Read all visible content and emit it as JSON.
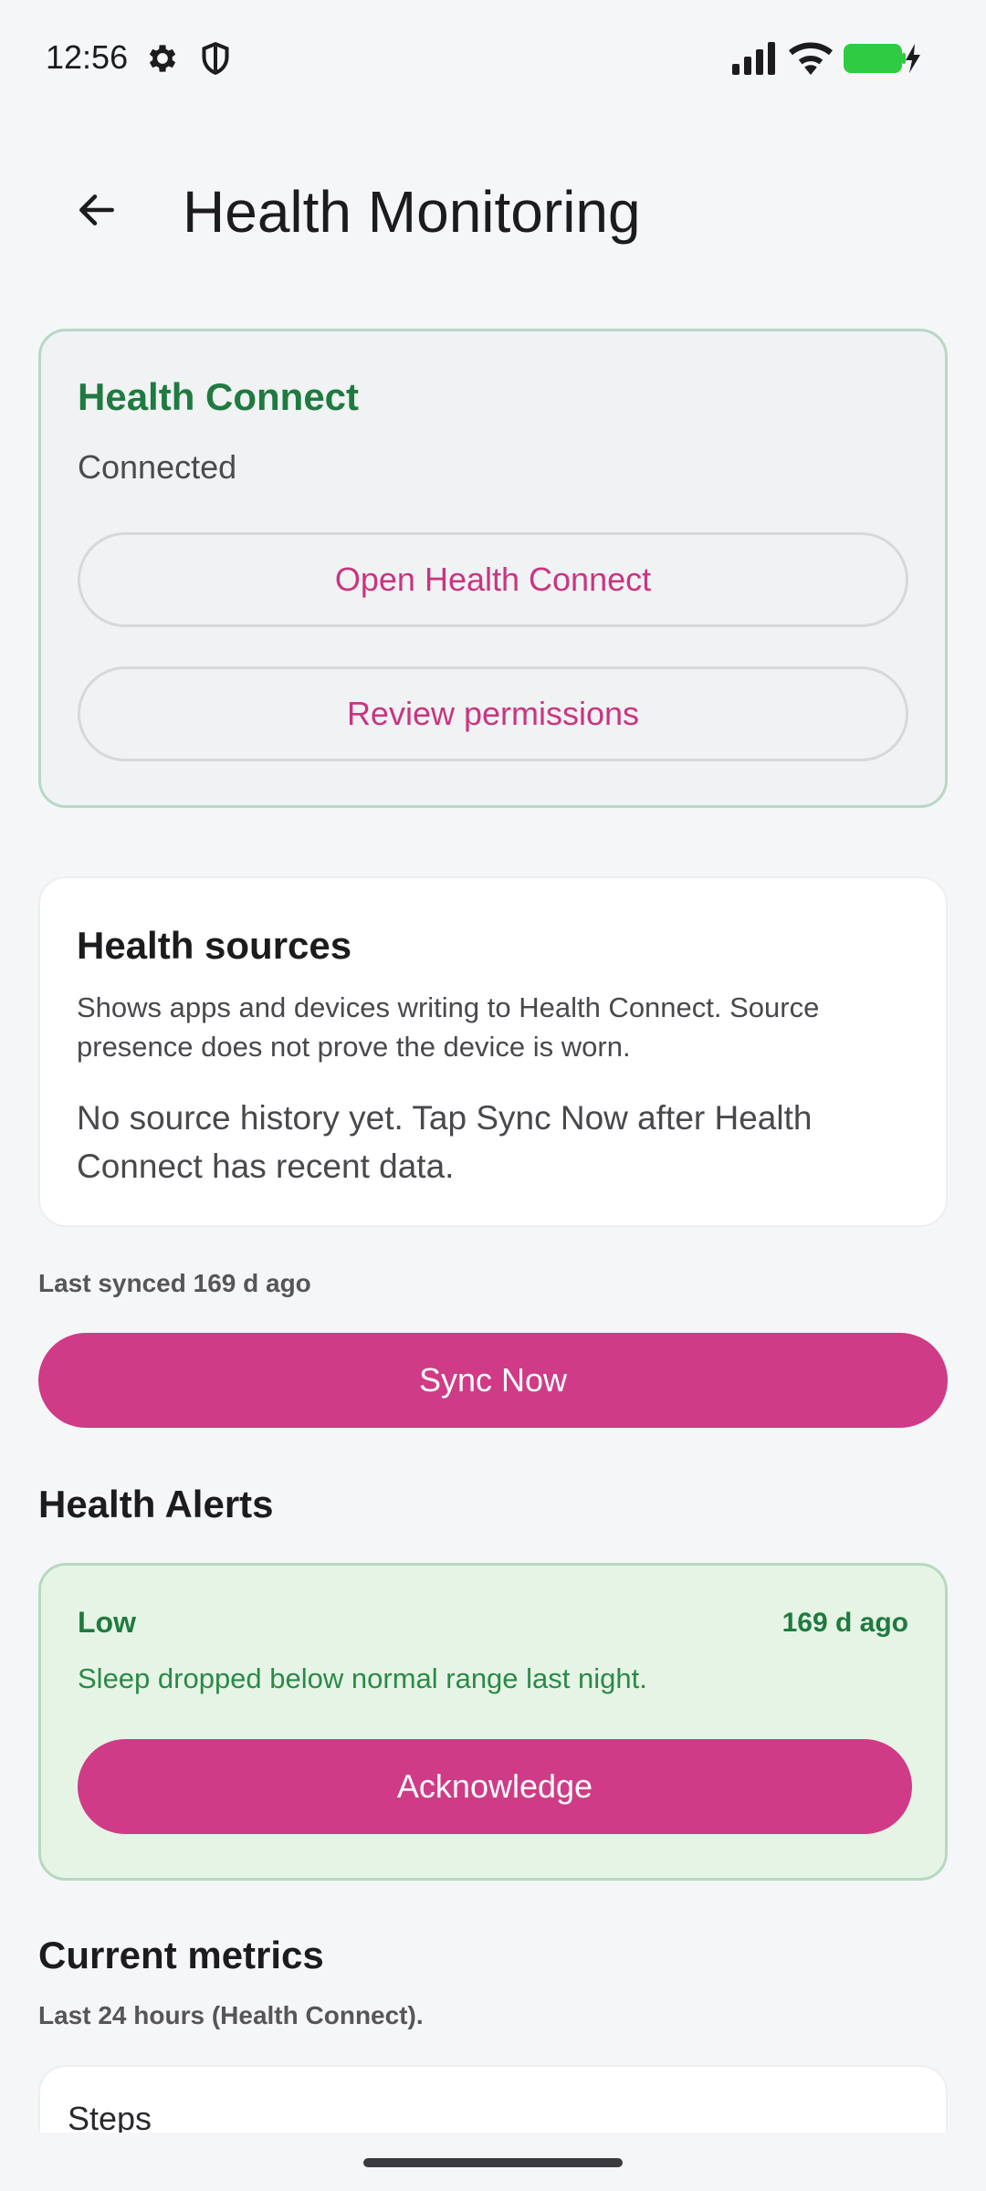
{
  "status_bar": {
    "time": "12:56",
    "icons": [
      "gear-icon",
      "shield-icon",
      "signal-icon",
      "wifi-icon",
      "battery-charging-icon"
    ],
    "battery_color": "#2ecc40"
  },
  "app_bar": {
    "back_icon": "arrow-left-icon",
    "title": "Health Monitoring"
  },
  "health_connect": {
    "title": "Health Connect",
    "status": "Connected",
    "open_label": "Open Health Connect",
    "review_label": "Review permissions"
  },
  "health_sources": {
    "title": "Health sources",
    "description": "Shows apps and devices writing to Health Connect. Source presence does not prove the device is worn.",
    "empty_message": "No source history yet. Tap Sync Now after Health Connect has recent data."
  },
  "sync": {
    "last_synced": "Last synced 169 d ago",
    "button_label": "Sync Now"
  },
  "alerts": {
    "title": "Health Alerts",
    "items": [
      {
        "level": "Low",
        "time": "169 d ago",
        "message": "Sleep dropped below normal range last night.",
        "action_label": "Acknowledge"
      }
    ]
  },
  "metrics": {
    "title": "Current metrics",
    "subtitle": "Last 24 hours (Health Connect).",
    "cards": [
      {
        "label": "Steps"
      }
    ]
  },
  "colors": {
    "accent": "#cf3b86",
    "success": "#1f7a3f",
    "alert_bg": "#e6f4e6"
  }
}
